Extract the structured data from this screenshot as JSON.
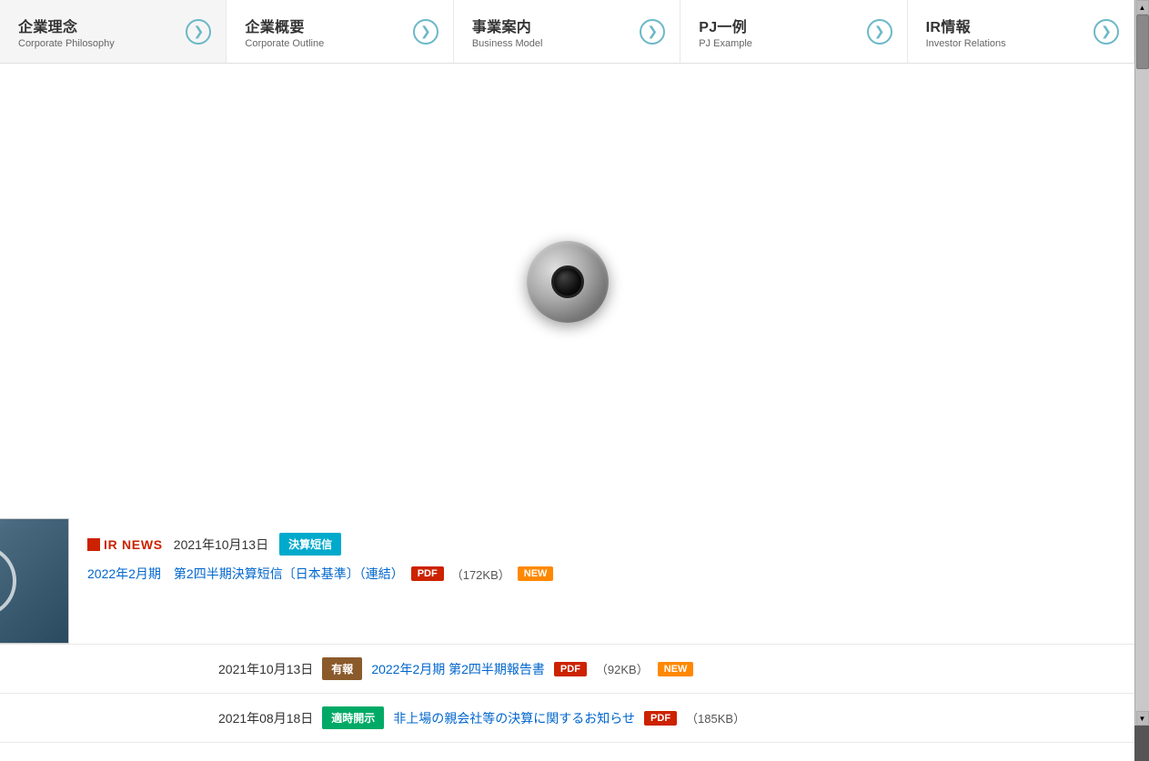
{
  "nav": {
    "items": [
      {
        "ja": "企業理念",
        "en": "Corporate Philosophy"
      },
      {
        "ja": "企業概要",
        "en": "Corporate Outline"
      },
      {
        "ja": "事業案内",
        "en": "Business Model"
      },
      {
        "ja": "PJ一例",
        "en": "PJ Example"
      },
      {
        "ja": "IR情報",
        "en": "Investor Relations"
      }
    ]
  },
  "ir_section": {
    "label": "IR NEWS",
    "rows": [
      {
        "date": "2021年10月13日",
        "tag": "決算短信",
        "tag_class": "tag-kessan",
        "link_text": "2022年2月期　第2四半期決算短信〔日本基準〕（連結）",
        "file_size": "（172KB）",
        "show_new": true
      },
      {
        "date": "2021年10月13日",
        "tag": "有報",
        "tag_class": "tag-yuko",
        "link_text": "2022年2月期 第2四半期報告書",
        "file_size": "（92KB）",
        "show_new": true
      },
      {
        "date": "2021年08月18日",
        "tag": "適時開示",
        "tag_class": "tag-toki",
        "link_text": "非上場の親会社等の決算に関するお知らせ",
        "file_size": "（185KB）",
        "show_new": false
      }
    ]
  },
  "badges": {
    "pdf": "PDF",
    "new": "NEW"
  }
}
